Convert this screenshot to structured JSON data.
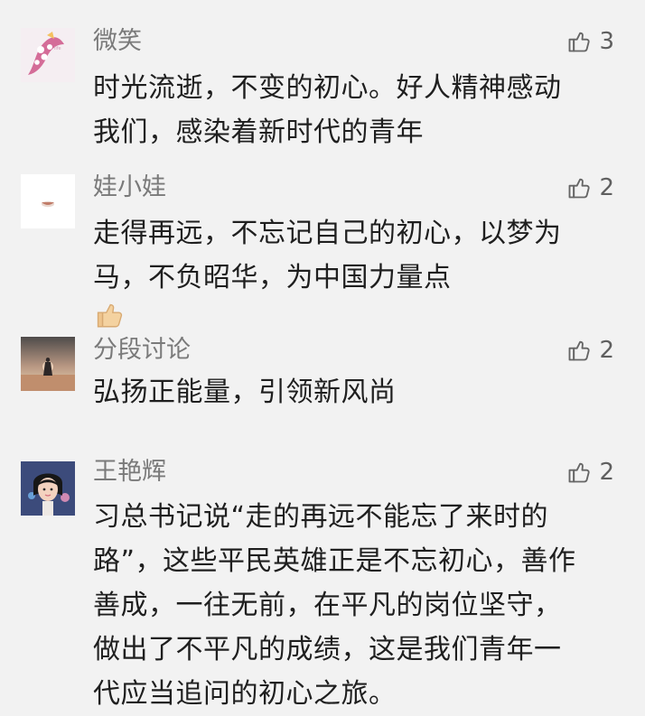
{
  "comments": [
    {
      "username": "微笑",
      "likes": "3",
      "lines": [
        "时光流逝，不变的初心。好人精神感动",
        "我们，感染着新时代的青年"
      ],
      "avatar": "pink-illustration-avatar"
    },
    {
      "username": "娃小娃",
      "likes": "2",
      "lines": [
        "走得再远，不忘记自己的初心，以梦为",
        "马，不负昭华，为中国力量点"
      ],
      "emoji": "thumbs-up-emoji",
      "avatar": "white-bowl-avatar"
    },
    {
      "username": "分段讨论",
      "likes": "2",
      "lines": [
        "弘扬正能量，引领新风尚"
      ],
      "avatar": "sunset-figure-avatar"
    },
    {
      "username": "王艳辉",
      "likes": "2",
      "lines": [
        "习总书记说“走的再远不能忘了来时的",
        "路”，这些平民英雄正是不忘初心，善作",
        "善成，一往无前，在平凡的岗位坚守，",
        "做出了不平凡的成绩，这是我们青年一",
        "代应当追问的初心之旅。"
      ],
      "avatar": "girl-portrait-avatar"
    }
  ],
  "colors": {
    "background": "#f2f2f2",
    "username": "#7a7a7a",
    "text": "#1f1f1f",
    "likes": "#5f5f5f"
  }
}
